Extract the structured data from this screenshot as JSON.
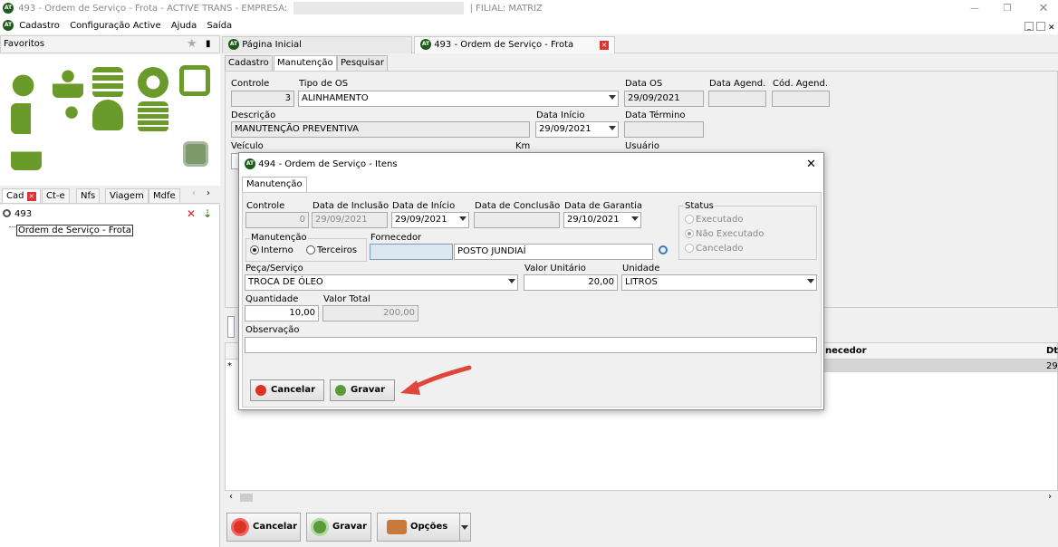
{
  "window": {
    "title": "493 - Ordem de Serviço - Frota - ACTIVE TRANS - EMPRESA:",
    "filial": "| FILIAL: MATRIZ",
    "logo": "AT"
  },
  "menu": [
    "Cadastro",
    "Configuração Active",
    "Ajuda",
    "Saída"
  ],
  "favorites": {
    "label": "Favoritos"
  },
  "left_tabs": [
    "Cad",
    "Ct-e",
    "Nfs",
    "Viagem",
    "Mdfe"
  ],
  "search": {
    "value": "493"
  },
  "tree": {
    "item": "Ordem de Serviço - Frota"
  },
  "doc_tabs": [
    "Página Inicial",
    "493 - Ordem de Serviço - Frota"
  ],
  "sub_tabs": [
    "Cadastro",
    "Manutenção",
    "Pesquisar"
  ],
  "form": {
    "controle_label": "Controle",
    "controle": "3",
    "tipo_os_label": "Tipo de OS",
    "tipo_os": "ALINHAMENTO",
    "data_os_label": "Data OS",
    "data_os": "29/09/2021",
    "data_agend_label": "Data Agend.",
    "cod_agend_label": "Cód. Agend.",
    "descricao_label": "Descrição",
    "descricao": "MANUTENÇÃO PREVENTIVA",
    "data_inicio_label": "Data Início",
    "data_inicio": "29/09/2021",
    "data_termino_label": "Data Término",
    "veiculo_label": "Veículo",
    "km_label": "Km",
    "usuario_label": "Usuário"
  },
  "grid": {
    "fornecedor_header": "necedor",
    "dt_header": "Dt",
    "row_dt": "29/"
  },
  "bottom": {
    "cancelar": "Cancelar",
    "gravar": "Gravar",
    "opcoes": "Opções"
  },
  "modal": {
    "title": "494 - Ordem de Serviço - Itens",
    "tab": "Manutenção",
    "controle_label": "Controle",
    "controle": "0",
    "data_inclusao_label": "Data de Inclusão",
    "data_inclusao": "29/09/2021",
    "data_inicio_label": "Data de Início",
    "data_inicio": "29/09/2021",
    "data_conclusao_label": "Data de Conclusão",
    "data_garantia_label": "Data de Garantia",
    "data_garantia": "29/10/2021",
    "status_label": "Status",
    "status_options": [
      "Executado",
      "Não Executado",
      "Cancelado"
    ],
    "manutencao_label": "Manutenção",
    "manutencao_options": [
      "Interno",
      "Terceiros"
    ],
    "fornecedor_label": "Fornecedor",
    "fornecedor": "POSTO JUNDIAÍ",
    "peca_label": "Peça/Serviço",
    "peca": "TROCA DE ÓLEO",
    "valor_unit_label": "Valor Unitário",
    "valor_unit": "20,00",
    "unidade_label": "Unidade",
    "unidade": "LITROS",
    "quantidade_label": "Quantidade",
    "quantidade": "10,00",
    "valor_total_label": "Valor Total",
    "valor_total": "200,00",
    "observacao_label": "Observação",
    "cancelar": "Cancelar",
    "gravar": "Gravar"
  },
  "colors": {
    "brand": "#1c5a1a",
    "icon_green": "#6a9a2a",
    "arrow": "#e0463a"
  }
}
